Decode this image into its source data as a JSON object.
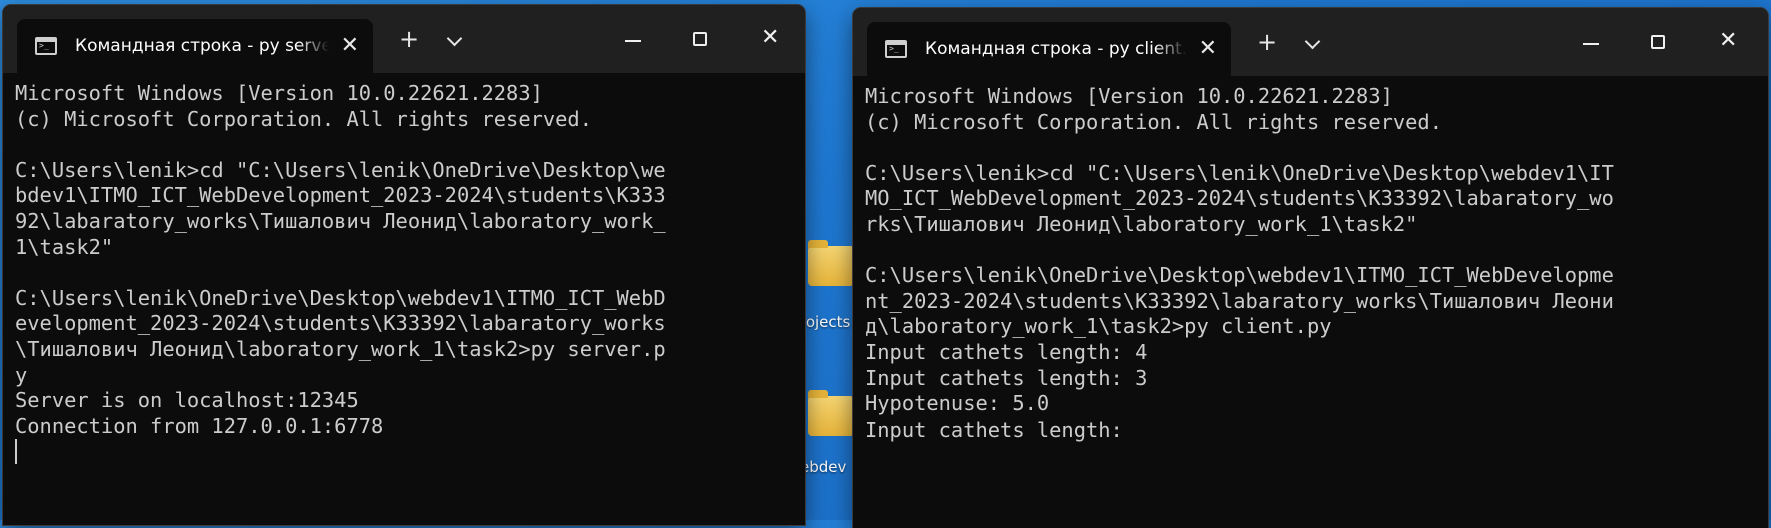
{
  "desktop": {
    "icon_labels": [
      "rojects",
      "ebdev"
    ]
  },
  "left_window": {
    "tab_title": "Командная строка - py  server.py",
    "lines": [
      "Microsoft Windows [Version 10.0.22621.2283]",
      "(c) Microsoft Corporation. All rights reserved.",
      "",
      "C:\\Users\\lenik>cd \"C:\\Users\\lenik\\OneDrive\\Desktop\\we",
      "bdev1\\ITMO_ICT_WebDevelopment_2023-2024\\students\\К333",
      "92\\labaratory_works\\Тишалович Леонид\\laboratory_work_",
      "1\\task2\"",
      "",
      "C:\\Users\\lenik\\OneDrive\\Desktop\\webdev1\\ITMO_ICT_WebD",
      "evelopment_2023-2024\\students\\К33392\\labaratory_works",
      "\\Тишалович Леонид\\laboratory_work_1\\task2>py server.p",
      "y",
      "Server is on localhost:12345",
      "Connection from 127.0.0.1:6778"
    ]
  },
  "right_window": {
    "tab_title": "Командная строка - py  client.py",
    "lines": [
      "Microsoft Windows [Version 10.0.22621.2283]",
      "(c) Microsoft Corporation. All rights reserved.",
      "",
      "C:\\Users\\lenik>cd \"C:\\Users\\lenik\\OneDrive\\Desktop\\webdev1\\IT",
      "MO_ICT_WebDevelopment_2023-2024\\students\\К33392\\labaratory_wo",
      "rks\\Тишалович Леонид\\laboratory_work_1\\task2\"",
      "",
      "C:\\Users\\lenik\\OneDrive\\Desktop\\webdev1\\ITMO_ICT_WebDevelopme",
      "nt_2023-2024\\students\\К33392\\labaratory_works\\Тишалович Леони",
      "д\\laboratory_work_1\\task2>py client.py",
      "Input cathets length: 4",
      "Input cathets length: 3",
      "Hypotenuse: 5.0",
      "Input cathets length: "
    ]
  }
}
